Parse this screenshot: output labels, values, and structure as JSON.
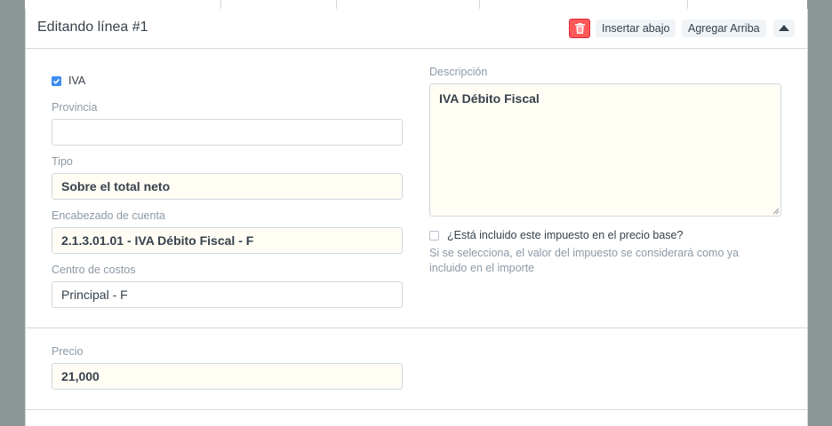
{
  "header": {
    "title": "Editando línea #1",
    "insert_below_label": "Insertar abajo",
    "add_above_label": "Agregar Arriba"
  },
  "fields": {
    "iva_label": "IVA",
    "iva_checked": true,
    "provincia_label": "Provincia",
    "provincia_value": "",
    "tipo_label": "Tipo",
    "tipo_value": "Sobre el total neto",
    "encabezado_label": "Encabezado de cuenta",
    "encabezado_value": "2.1.3.01.01 - IVA Débito Fiscal - F",
    "centro_label": "Centro de costos",
    "centro_value": "Principal - F",
    "descripcion_label": "Descripción",
    "descripcion_value": "IVA Débito Fiscal",
    "included_label": "¿Está incluido este impuesto en el precio base?",
    "included_checked": false,
    "included_help": "Si se selecciona, el valor del impuesto se considerará como ya incluido en el importe",
    "precio_label": "Precio",
    "precio_value": "21,000"
  },
  "colors": {
    "delete_button": "#ff5858",
    "checkbox_checked": "#3b8df0",
    "filled_field_bg": "#fffdf4"
  },
  "icons": {
    "delete": "trash-icon",
    "collapse": "caret-up-icon",
    "check": "check-icon"
  }
}
